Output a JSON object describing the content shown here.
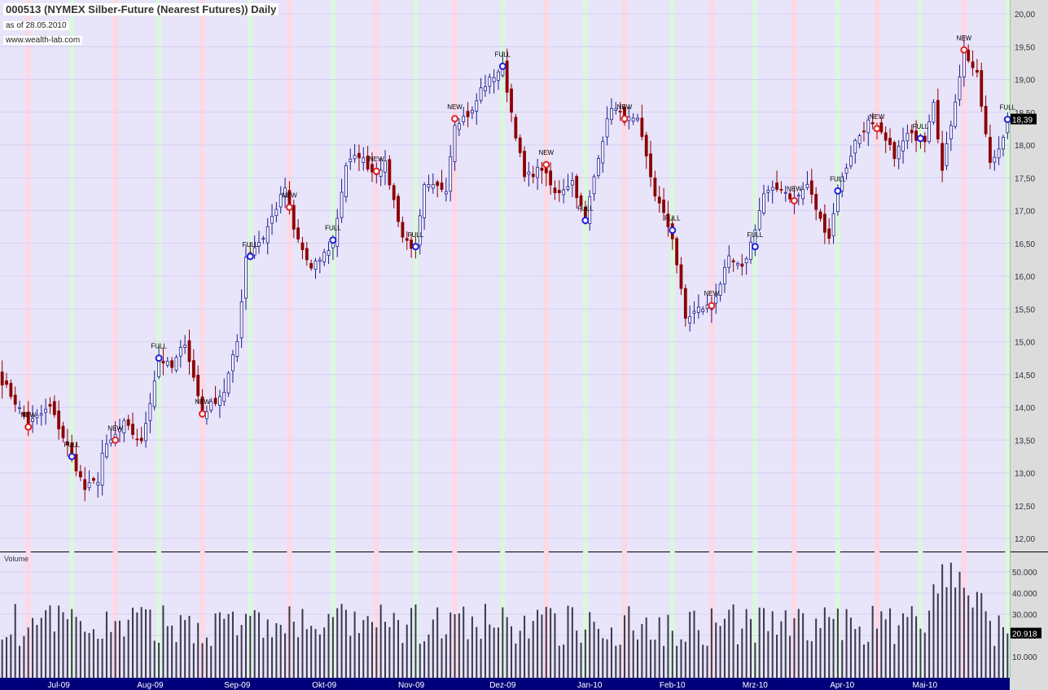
{
  "header": {
    "title": "000513 (NYMEX Silber-Future (Nearest Futures)) Daily",
    "asof": "as of 28.05.2010",
    "site": "www.wealth-lab.com"
  },
  "volume_label": "Volume",
  "colors": {
    "bg": "#e8e4fa",
    "up": "#1c1c8c",
    "down": "#8b0000",
    "new": "#e02020",
    "full": "#2020e0",
    "axis_bg": "#dcdcdc",
    "date_bar": "#00007a"
  },
  "chart_data": {
    "type": "candlestick",
    "bars": 232,
    "price_ticks": [
      "12,00",
      "12,50",
      "13,00",
      "13,50",
      "14,00",
      "14,50",
      "15,00",
      "15,50",
      "16,00",
      "16,50",
      "17,00",
      "17,50",
      "18,00",
      "18,50",
      "19,00",
      "19,50",
      "20,00"
    ],
    "ylim": [
      11.75,
      20.2
    ],
    "last_price": "18,39",
    "close_waypoints": [
      [
        0,
        14.4
      ],
      [
        1,
        14.3
      ],
      [
        6,
        13.75
      ],
      [
        11,
        14.0
      ],
      [
        16,
        13.25
      ],
      [
        19,
        12.75
      ],
      [
        22,
        12.9
      ],
      [
        23,
        13.3
      ],
      [
        28,
        13.75
      ],
      [
        32,
        13.45
      ],
      [
        36,
        14.75
      ],
      [
        39,
        14.6
      ],
      [
        42,
        15.0
      ],
      [
        46,
        13.9
      ],
      [
        51,
        14.25
      ],
      [
        54,
        15.0
      ],
      [
        56,
        16.3
      ],
      [
        60,
        16.6
      ],
      [
        65,
        17.35
      ],
      [
        67,
        16.7
      ],
      [
        71,
        16.1
      ],
      [
        76,
        16.5
      ],
      [
        79,
        17.7
      ],
      [
        82,
        17.85
      ],
      [
        85,
        17.6
      ],
      [
        88,
        17.7
      ],
      [
        92,
        16.6
      ],
      [
        95,
        16.4
      ],
      [
        97,
        17.35
      ],
      [
        102,
        17.35
      ],
      [
        104,
        18.35
      ],
      [
        108,
        18.5
      ],
      [
        110,
        18.85
      ],
      [
        115,
        19.2
      ],
      [
        117,
        18.5
      ],
      [
        120,
        17.5
      ],
      [
        124,
        17.65
      ],
      [
        127,
        17.25
      ],
      [
        131,
        17.45
      ],
      [
        134,
        16.85
      ],
      [
        137,
        17.85
      ],
      [
        140,
        18.6
      ],
      [
        143,
        18.4
      ],
      [
        146,
        18.35
      ],
      [
        150,
        17.25
      ],
      [
        154,
        16.6
      ],
      [
        157,
        15.35
      ],
      [
        160,
        15.5
      ],
      [
        163,
        15.55
      ],
      [
        167,
        16.25
      ],
      [
        170,
        16.1
      ],
      [
        172,
        16.5
      ],
      [
        175,
        17.25
      ],
      [
        179,
        17.35
      ],
      [
        182,
        17.15
      ],
      [
        185,
        17.4
      ],
      [
        188,
        16.85
      ],
      [
        190,
        16.6
      ],
      [
        192,
        17.3
      ],
      [
        196,
        18.05
      ],
      [
        199,
        18.35
      ],
      [
        202,
        18.15
      ],
      [
        205,
        17.85
      ],
      [
        208,
        18.15
      ],
      [
        212,
        18.1
      ],
      [
        214,
        18.7
      ],
      [
        216,
        17.6
      ],
      [
        219,
        18.7
      ],
      [
        221,
        19.45
      ],
      [
        224,
        19.05
      ],
      [
        227,
        17.7
      ],
      [
        229,
        17.95
      ],
      [
        231,
        18.39
      ]
    ],
    "signals": [
      {
        "bar": 6,
        "price": 13.7,
        "label": "NEW"
      },
      {
        "bar": 16,
        "price": 13.25,
        "label": "FULL"
      },
      {
        "bar": 26,
        "price": 13.5,
        "label": "NEW"
      },
      {
        "bar": 36,
        "price": 14.75,
        "label": "FULL"
      },
      {
        "bar": 46,
        "price": 13.9,
        "label": "NEW"
      },
      {
        "bar": 57,
        "price": 16.3,
        "label": "FULL"
      },
      {
        "bar": 66,
        "price": 17.05,
        "label": "NEW"
      },
      {
        "bar": 76,
        "price": 16.55,
        "label": "FULL"
      },
      {
        "bar": 86,
        "price": 17.6,
        "label": "NEW"
      },
      {
        "bar": 95,
        "price": 16.45,
        "label": "FULL"
      },
      {
        "bar": 104,
        "price": 18.4,
        "label": "NEW"
      },
      {
        "bar": 115,
        "price": 19.2,
        "label": "FULL"
      },
      {
        "bar": 125,
        "price": 17.7,
        "label": "NEW"
      },
      {
        "bar": 134,
        "price": 16.85,
        "label": "FULL"
      },
      {
        "bar": 143,
        "price": 18.4,
        "label": "NEW"
      },
      {
        "bar": 154,
        "price": 16.7,
        "label": "FULL"
      },
      {
        "bar": 163,
        "price": 15.55,
        "label": "NEW"
      },
      {
        "bar": 173,
        "price": 16.45,
        "label": "FULL"
      },
      {
        "bar": 182,
        "price": 17.15,
        "label": "NEW"
      },
      {
        "bar": 192,
        "price": 17.3,
        "label": "FULL"
      },
      {
        "bar": 201,
        "price": 18.25,
        "label": "NEW"
      },
      {
        "bar": 211,
        "price": 18.1,
        "label": "FULL"
      },
      {
        "bar": 221,
        "price": 19.45,
        "label": "NEW"
      },
      {
        "bar": 231,
        "price": 18.39,
        "label": "FULL"
      }
    ],
    "volume_ticks": [
      "10.000",
      "20.000",
      "30.000",
      "40.000",
      "50.000"
    ],
    "volume_ylim": [
      0,
      58000
    ],
    "last_volume": "20.918",
    "volume_typical": [
      15000,
      35000
    ],
    "months": [
      {
        "bar": 13,
        "label": "Jul-09"
      },
      {
        "bar": 34,
        "label": "Aug-09"
      },
      {
        "bar": 54,
        "label": "Sep-09"
      },
      {
        "bar": 74,
        "label": "Okt-09"
      },
      {
        "bar": 94,
        "label": "Nov-09"
      },
      {
        "bar": 115,
        "label": "Dez-09"
      },
      {
        "bar": 135,
        "label": "Jan-10"
      },
      {
        "bar": 154,
        "label": "Feb-10"
      },
      {
        "bar": 173,
        "label": "Mrz-10"
      },
      {
        "bar": 193,
        "label": "Apr-10"
      },
      {
        "bar": 212,
        "label": "Mai-10"
      }
    ]
  }
}
